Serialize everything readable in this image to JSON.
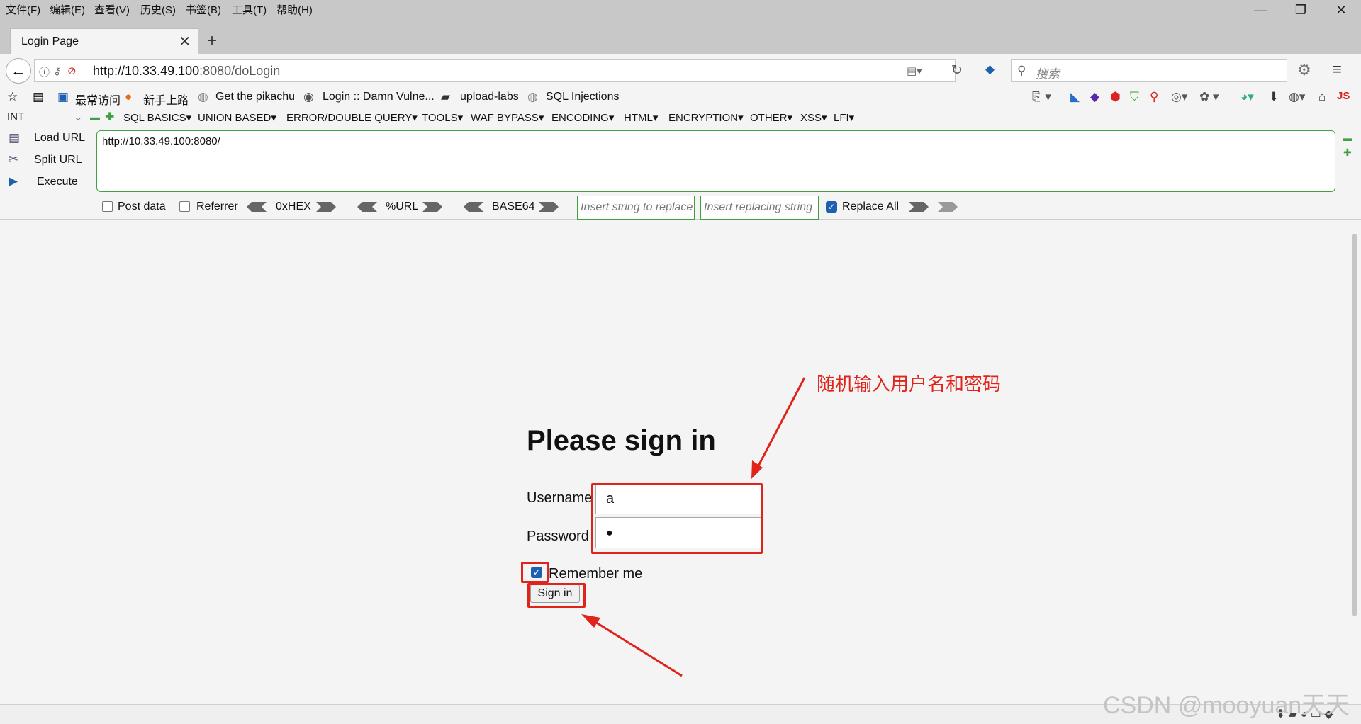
{
  "menu": [
    "文件(F)",
    "编辑(E)",
    "查看(V)",
    "历史(S)",
    "书签(B)",
    "工具(T)",
    "帮助(H)"
  ],
  "window": {
    "minimize": "—",
    "restore": "❐",
    "close": "✕"
  },
  "tab": {
    "title": "Login Page",
    "close": "✕",
    "new": "+"
  },
  "nav": {
    "url_host": "http://10.33.49.100",
    "url_rest": ":8080/doLogin",
    "search_placeholder": "搜索"
  },
  "bookmarks": [
    "最常访问",
    "新手上路",
    "Get the pikachu",
    "Login :: Damn Vulne...",
    "upload-labs",
    "SQL Injections"
  ],
  "hackbar": {
    "type": "INT",
    "menus": [
      "SQL BASICS▾",
      "UNION BASED▾",
      "ERROR/DOUBLE QUERY▾",
      "TOOLS▾",
      "WAF BYPASS▾",
      "ENCODING▾",
      "HTML▾",
      "ENCRYPTION▾",
      "OTHER▾",
      "XSS▾",
      "LFI▾"
    ],
    "load_url": "Load URL",
    "split_url": "Split URL",
    "execute": "Execute",
    "url_value": "http://10.33.49.100:8080/",
    "post_data": "Post data",
    "referrer": "Referrer",
    "hex": "0xHEX",
    "urlenc": "%URL",
    "base64": "BASE64",
    "replace_placeholder": "Insert string to replace",
    "replacing_placeholder": "Insert replacing string",
    "replace_all": "Replace All"
  },
  "login": {
    "heading": "Please sign in",
    "username_label": "Username",
    "username_value": "a",
    "password_label": "Password",
    "password_value": "●",
    "remember_label": "Remember me",
    "remember_checked": true,
    "signin_label": "Sign in"
  },
  "annotation": {
    "text": "随机输入用户名和密码",
    "color": "#e0241b"
  },
  "watermark": "CSDN @mooyuan天天",
  "colors": {
    "accent": "#1f5fb0",
    "hackbar_border": "#3fa13f",
    "annotation": "#e0241b"
  }
}
